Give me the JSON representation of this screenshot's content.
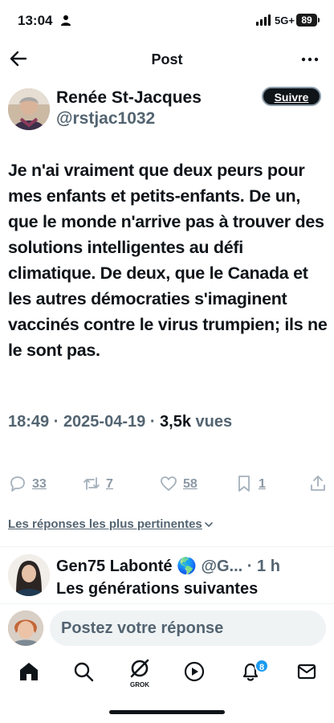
{
  "status_bar": {
    "time": "13:04",
    "network": "5G+",
    "battery": "89"
  },
  "header": {
    "title": "Post",
    "back_icon": "arrow-left-icon",
    "more_icon": "more-horizontal-icon"
  },
  "author": {
    "name": "Renée St-Jacques",
    "handle": "@rstjac1032",
    "follow_label": "Suivre"
  },
  "tweet": {
    "text": "Je n'ai vraiment que deux peurs pour mes enfants et petits-enfants. De un, que le monde n'arrive pas à trouver des solutions intelligentes au défi climatique. De deux, que le Canada et les autres démocraties s'imaginent vaccinés contre le virus trumpien; ils ne le sont pas.",
    "time": "18:49",
    "date": "2025-04-19",
    "views_count": "3,5k",
    "views_label": "vues"
  },
  "actions": {
    "replies": "33",
    "reposts": "7",
    "likes": "58",
    "bookmarks": "1"
  },
  "filter": {
    "label": "Les réponses les plus pertinentes"
  },
  "reply": {
    "name": "Gen75 Labonté 🌎",
    "handle": "@G...",
    "age": "· 1 h",
    "text": "Les générations suivantes"
  },
  "compose": {
    "placeholder": "Postez votre réponse"
  },
  "bottom_nav": {
    "grok_label": "GROK",
    "notifications_badge": "8"
  },
  "colors": {
    "text": "#0f1419",
    "secondary": "#536471",
    "accent": "#1d9bf0"
  }
}
